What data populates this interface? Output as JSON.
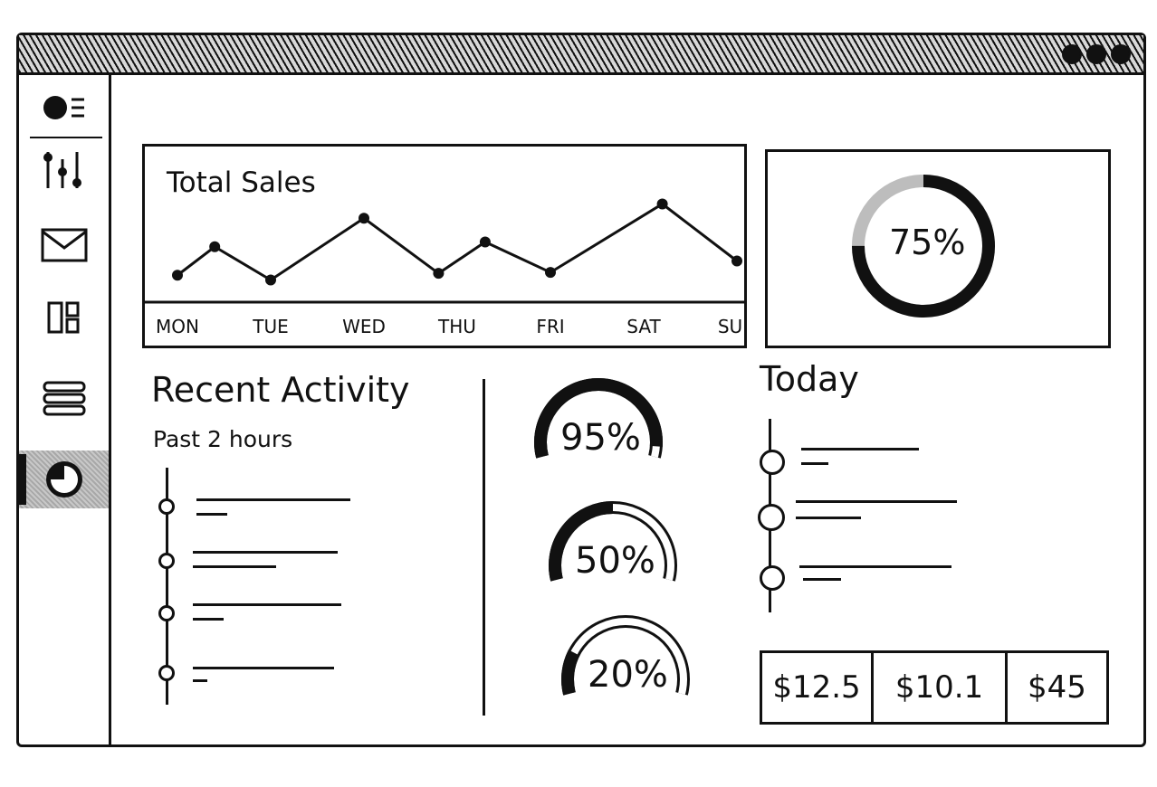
{
  "window": {
    "controls": [
      "window-control",
      "window-control",
      "window-control"
    ]
  },
  "sidebar": {
    "items": [
      {
        "name": "menu",
        "icon": "menu-icon"
      },
      {
        "name": "settings",
        "icon": "sliders-icon"
      },
      {
        "name": "mail",
        "icon": "mail-icon"
      },
      {
        "name": "widgets",
        "icon": "grid-icon"
      },
      {
        "name": "layers",
        "icon": "layers-icon"
      },
      {
        "name": "reports",
        "icon": "pie-chart-icon",
        "active": true
      }
    ]
  },
  "total_sales": {
    "title": "Total Sales",
    "chart_data": {
      "type": "line",
      "title": "Total Sales",
      "categories": [
        "MON",
        "TUE",
        "WED",
        "THU",
        "FRI",
        "SAT",
        "SUN"
      ],
      "points": [
        {
          "x": 0,
          "y": 1.5
        },
        {
          "x": 0.4,
          "y": 4.5
        },
        {
          "x": 1,
          "y": 1
        },
        {
          "x": 2,
          "y": 7.5
        },
        {
          "x": 2.8,
          "y": 1.7
        },
        {
          "x": 3.3,
          "y": 5
        },
        {
          "x": 4,
          "y": 1.8
        },
        {
          "x": 5.2,
          "y": 9
        },
        {
          "x": 6,
          "y": 3
        }
      ],
      "xlabel": "",
      "ylabel": "",
      "grid": false
    }
  },
  "overall_progress": {
    "label": "75%",
    "value": 0.75
  },
  "recent_activity": {
    "title": "Recent Activity",
    "subtitle": "Past 2 hours",
    "items": [
      {
        "id": 1
      },
      {
        "id": 2
      },
      {
        "id": 3
      },
      {
        "id": 4
      }
    ]
  },
  "gauges": [
    {
      "label": "95%",
      "value": 0.95
    },
    {
      "label": "50%",
      "value": 0.5
    },
    {
      "label": "20%",
      "value": 0.2
    }
  ],
  "today": {
    "title": "Today",
    "items": [
      {
        "id": 1
      },
      {
        "id": 2
      },
      {
        "id": 3
      }
    ]
  },
  "amounts": [
    "$12.5",
    "$10.1",
    "$45"
  ],
  "colors": {
    "ink": "#111111",
    "fill_light": "#bdbdbd",
    "background": "#ffffff"
  }
}
